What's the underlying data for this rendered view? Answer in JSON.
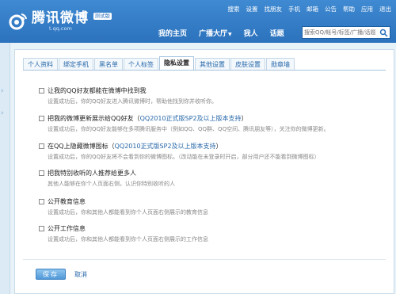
{
  "header": {
    "top_links": [
      "搜索",
      "设置",
      "找朋友",
      "手机",
      "邮箱",
      "公告",
      "帮助",
      "应用",
      "退出"
    ],
    "logo_text": "腾讯微博",
    "logo_badge": "测试版",
    "logo_url": "t.qq.com",
    "nav": {
      "home": "我的主页",
      "plaza": "广播大厅",
      "plaza_caret": "▼",
      "me": "我人",
      "topic": "话题"
    },
    "search_placeholder": "搜索QQ/帐号/标签/广播/话题"
  },
  "tabs": [
    {
      "label": "个人资料",
      "active": false
    },
    {
      "label": "绑定手机",
      "active": false
    },
    {
      "label": "黑名单",
      "active": false
    },
    {
      "label": "个人标签",
      "active": false
    },
    {
      "label": "隐私设置",
      "active": true
    },
    {
      "label": "其他设置",
      "active": false
    },
    {
      "label": "皮肤设置",
      "active": false
    },
    {
      "label": "勋章墙",
      "active": false
    }
  ],
  "options": [
    {
      "title": "让我的QQ好友都能在微博中找到我",
      "desc": "设置成功后，你的QQ好友进入腾讯微博时，帮助他找到你并收听你。"
    },
    {
      "title_before": "把我的微博更新展示给QQ好友（",
      "title_link": "QQ2010正式版SP2及以上版本支持",
      "title_after": "）",
      "desc": "设置成功后，你的QQ好友能够在多项腾讯服务中（例如QQ、QQ群、QQ空间、腾讯朋友等），关注你的微博更新。"
    },
    {
      "title_before": "在QQ上隐藏微博图标（",
      "title_link": "QQ2010正式版SP2及以上版本支持",
      "title_after": "）",
      "desc": "设置成功后，你的QQ好友将不会看到你的微博图标。（改动能在未登录时开启，部分用户还不能看到微博图标）"
    },
    {
      "title": "把我特别收听的人推荐给更多人",
      "desc": "其他人能够在你个人页面右侧，认识你特别收听的人"
    },
    {
      "title": "公开教育信息",
      "desc": "设置成功后，你和其他人都能看到你个人页面右侧展示的教育信息"
    },
    {
      "title": "公开工作信息",
      "desc": "设置成功后，你和其他人都能看到你个人页面右侧展示的工作信息"
    }
  ],
  "actions": {
    "save": "保存",
    "cancel": "取消"
  },
  "colors": {
    "header_blue": "#2c72bd",
    "link_blue": "#2566a8",
    "background": "#e8f2f9"
  }
}
